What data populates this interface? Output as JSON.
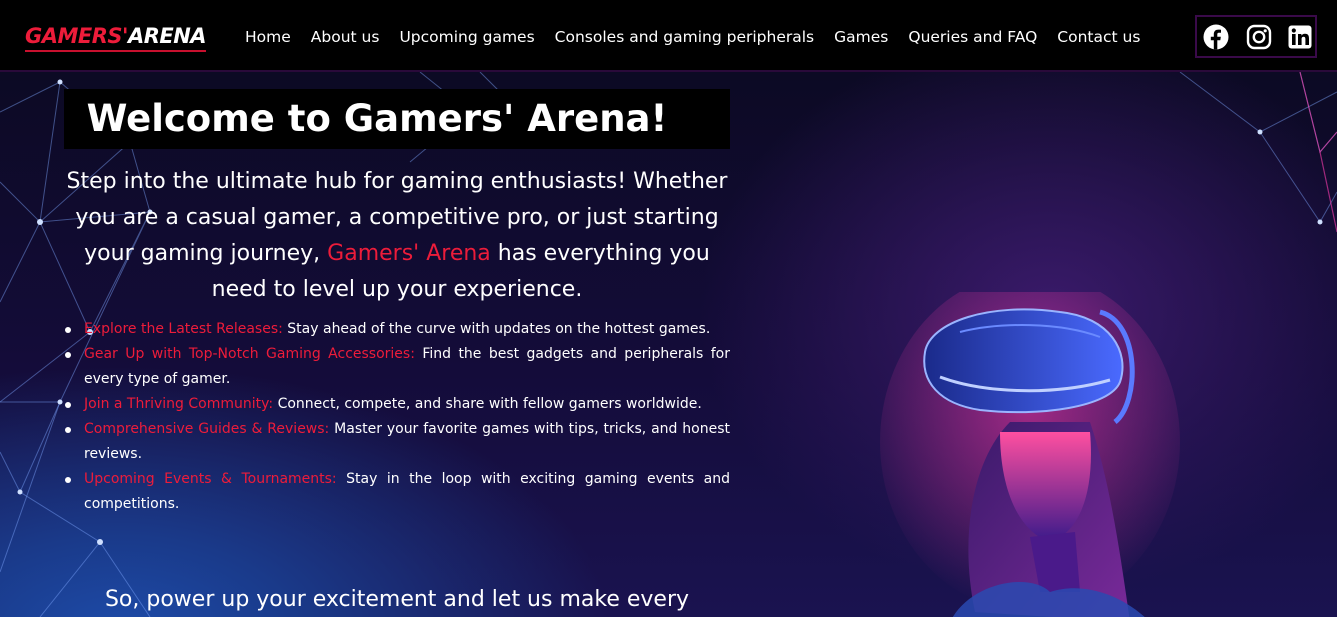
{
  "brand": {
    "part1": "GAMERS'",
    "part2": "ARENA",
    "color_primary": "#ed1c3a",
    "color_secondary": "#ffffff"
  },
  "nav": {
    "items": [
      {
        "label": "Home"
      },
      {
        "label": "About us"
      },
      {
        "label": "Upcoming games"
      },
      {
        "label": "Consoles and gaming peripherals"
      },
      {
        "label": "Games"
      },
      {
        "label": "Queries and FAQ"
      },
      {
        "label": "Contact us"
      }
    ]
  },
  "social": {
    "icons": [
      "facebook-icon",
      "instagram-icon",
      "linkedin-icon"
    ]
  },
  "hero": {
    "title": "Welcome to Gamers' Arena!",
    "intro_before": "Step into the ultimate hub for gaming enthusiasts! Whether you are a casual gamer, a competitive pro, or just starting your gaming journey, ",
    "intro_highlight": "Gamers' Arena",
    "intro_after": " has everything you need to level up your experience.",
    "features": [
      {
        "lead": "Explore the Latest Releases:",
        "text": " Stay ahead of the curve with updates on the hottest games."
      },
      {
        "lead": "Gear Up with Top-Notch Gaming Accessories:",
        "text": " Find the best gadgets and peripherals for every type of gamer."
      },
      {
        "lead": "Join a Thriving Community:",
        "text": " Connect, compete, and share with fellow gamers worldwide."
      },
      {
        "lead": "Comprehensive Guides & Reviews:",
        "text": " Master your favorite games with tips, tricks, and honest reviews."
      },
      {
        "lead": "Upcoming Events & Tournaments:",
        "text": " Stay in the loop with exciting gaming events and competitions."
      }
    ],
    "outro": "So, power up your excitement and let us make every",
    "accent_color": "#ed1c3a"
  }
}
